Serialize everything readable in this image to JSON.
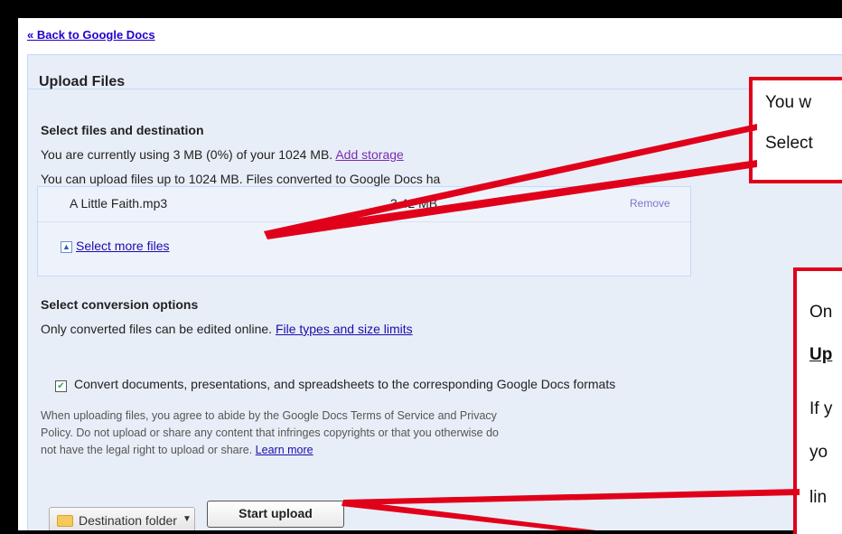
{
  "back_link": "« Back to Google Docs",
  "panel": {
    "title": "Upload Files"
  },
  "section1": {
    "heading": "Select files and destination",
    "storage_text": "You are currently using 3 MB (0%) of your 1024 MB.",
    "storage_link": "Add storage",
    "limit_text": "You can upload files up to 1024 MB. Files converted to Google Docs ha"
  },
  "file": {
    "name": "A Little Faith.mp3",
    "size": "3.42 MB",
    "remove": "Remove"
  },
  "select_more": "Select more files",
  "section2": {
    "heading": "Select conversion options",
    "text": "Only converted files can be edited online.",
    "link": "File types and size limits",
    "checkbox_label": "Convert documents, presentations, and spreadsheets to the corresponding Google Docs formats",
    "checked": true
  },
  "terms": {
    "line1": "When uploading files, you agree to abide by the Google Docs Terms of Service and Privacy",
    "line2": "Policy. Do not upload or share any content that infringes copyrights or that you otherwise do",
    "line3": "not have the legal right to upload or share.",
    "link": "Learn more"
  },
  "buttons": {
    "destination": "Destination folder",
    "start": "Start upload"
  },
  "callout1": {
    "line1": "You w",
    "line2": "Select"
  },
  "callout2": {
    "line1": "On",
    "line2": "Up",
    "line3": "If y",
    "line4": "yo",
    "line5": "lin"
  },
  "colors": {
    "callout_border": "#e0001a",
    "panel_bg": "#e8eef7",
    "link": "#1a0dab"
  }
}
